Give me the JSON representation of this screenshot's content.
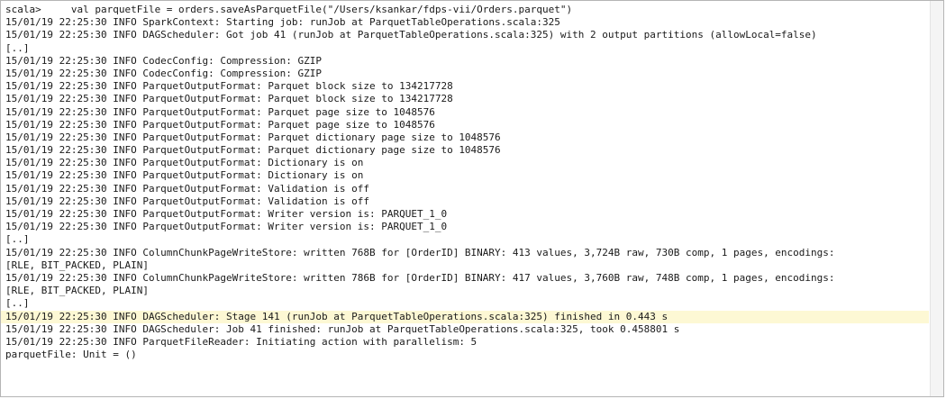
{
  "terminal": {
    "highlight_color": "#fdf8d4",
    "lines": [
      "scala>     val parquetFile = orders.saveAsParquetFile(\"/Users/ksankar/fdps-vii/Orders.parquet\")",
      "15/01/19 22:25:30 INFO SparkContext: Starting job: runJob at ParquetTableOperations.scala:325",
      "15/01/19 22:25:30 INFO DAGScheduler: Got job 41 (runJob at ParquetTableOperations.scala:325) with 2 output partitions (allowLocal=false)",
      "[..]",
      "15/01/19 22:25:30 INFO CodecConfig: Compression: GZIP",
      "15/01/19 22:25:30 INFO CodecConfig: Compression: GZIP",
      "15/01/19 22:25:30 INFO ParquetOutputFormat: Parquet block size to 134217728",
      "15/01/19 22:25:30 INFO ParquetOutputFormat: Parquet block size to 134217728",
      "15/01/19 22:25:30 INFO ParquetOutputFormat: Parquet page size to 1048576",
      "15/01/19 22:25:30 INFO ParquetOutputFormat: Parquet page size to 1048576",
      "15/01/19 22:25:30 INFO ParquetOutputFormat: Parquet dictionary page size to 1048576",
      "15/01/19 22:25:30 INFO ParquetOutputFormat: Parquet dictionary page size to 1048576",
      "15/01/19 22:25:30 INFO ParquetOutputFormat: Dictionary is on",
      "15/01/19 22:25:30 INFO ParquetOutputFormat: Dictionary is on",
      "15/01/19 22:25:30 INFO ParquetOutputFormat: Validation is off",
      "15/01/19 22:25:30 INFO ParquetOutputFormat: Validation is off",
      "15/01/19 22:25:30 INFO ParquetOutputFormat: Writer version is: PARQUET_1_0",
      "15/01/19 22:25:30 INFO ParquetOutputFormat: Writer version is: PARQUET_1_0",
      "[..]",
      "15/01/19 22:25:30 INFO ColumnChunkPageWriteStore: written 768B for [OrderID] BINARY: 413 values, 3,724B raw, 730B comp, 1 pages, encodings:",
      "[RLE, BIT_PACKED, PLAIN]",
      "15/01/19 22:25:30 INFO ColumnChunkPageWriteStore: written 786B for [OrderID] BINARY: 417 values, 3,760B raw, 748B comp, 1 pages, encodings:",
      "[RLE, BIT_PACKED, PLAIN]",
      "[..]",
      "15/01/19 22:25:30 INFO DAGScheduler: Stage 141 (runJob at ParquetTableOperations.scala:325) finished in 0.443 s",
      "15/01/19 22:25:30 INFO DAGScheduler: Job 41 finished: runJob at ParquetTableOperations.scala:325, took 0.458801 s",
      "15/01/19 22:25:30 INFO ParquetFileReader: Initiating action with parallelism: 5",
      "parquetFile: Unit = ()"
    ],
    "highlighted_line_index": 24
  }
}
